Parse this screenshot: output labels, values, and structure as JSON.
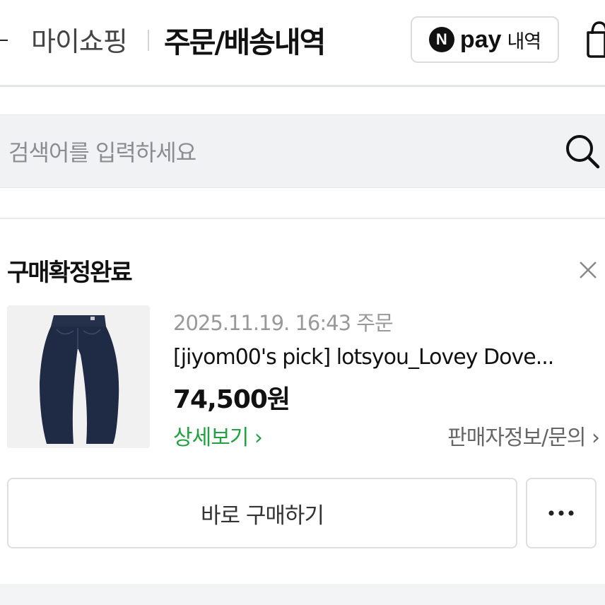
{
  "header": {
    "breadcrumb": "마이쇼핑",
    "title": "주문/배송내역",
    "npay": {
      "logo_letter": "N",
      "word": "pay",
      "sub_label": "내역"
    },
    "icons": {
      "back": "back-arrow-icon",
      "cart": "shopping-bag-icon"
    }
  },
  "search": {
    "placeholder": "검색어를 입력하세요",
    "value": "",
    "icon": "search-icon"
  },
  "order": {
    "status": "구매확정완료",
    "date": "2025.11.19. 16:43 주문",
    "product_name": "[jiyom00's pick] lotsyou_Lovey Dove...",
    "price": "74,500원",
    "detail_link": "상세보기 ›",
    "seller_link": "판매자정보/문의 ›",
    "buy_button": "바로 구매하기",
    "more_button": "···",
    "thumbnail": "denim-pants-image"
  },
  "colors": {
    "accent_green": "#1fa340",
    "text_primary": "#111111",
    "text_muted": "#999999",
    "border": "#dedfe2",
    "search_bg": "#f1f2f4"
  }
}
